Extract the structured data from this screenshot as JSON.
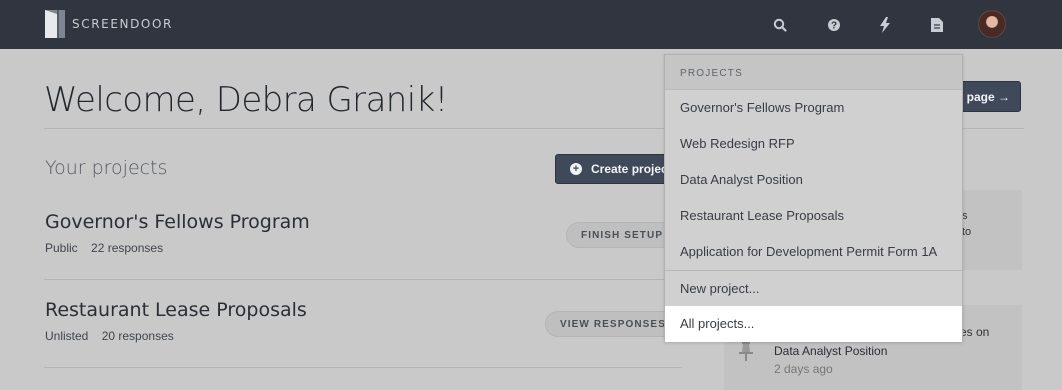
{
  "nav": {
    "brand": "SCREENDOOR",
    "icons": [
      "search-icon",
      "help-icon",
      "lightning-icon",
      "document-icon"
    ]
  },
  "main": {
    "welcome": "Welcome, Debra Granik!",
    "section_title": "Your projects",
    "create_button": "Create project",
    "page_button": "page →"
  },
  "projects": [
    {
      "name": "Governor's Fellows Program",
      "visibility": "Public",
      "responses": "22 responses",
      "action": "FINISH SETUP →"
    },
    {
      "name": "Restaurant Lease Proposals",
      "visibility": "Unlisted",
      "responses": "20 responses",
      "action": "VIEW RESPONSES →"
    }
  ],
  "dropdown": {
    "header": "PROJECTS",
    "items": [
      "Governor's Fellows Program",
      "Web Redesign RFP",
      "Data Analyst Position",
      "Restaurant Lease Proposals",
      "Application for Development Permit Form 1A"
    ],
    "new_project": "New project...",
    "all_projects": "All projects..."
  },
  "feed": {
    "item1_line1": "s",
    "item1_line2": "to",
    "item2_line1": "es on",
    "item2_project": "Data Analyst Position",
    "item2_time": "2 days ago"
  }
}
